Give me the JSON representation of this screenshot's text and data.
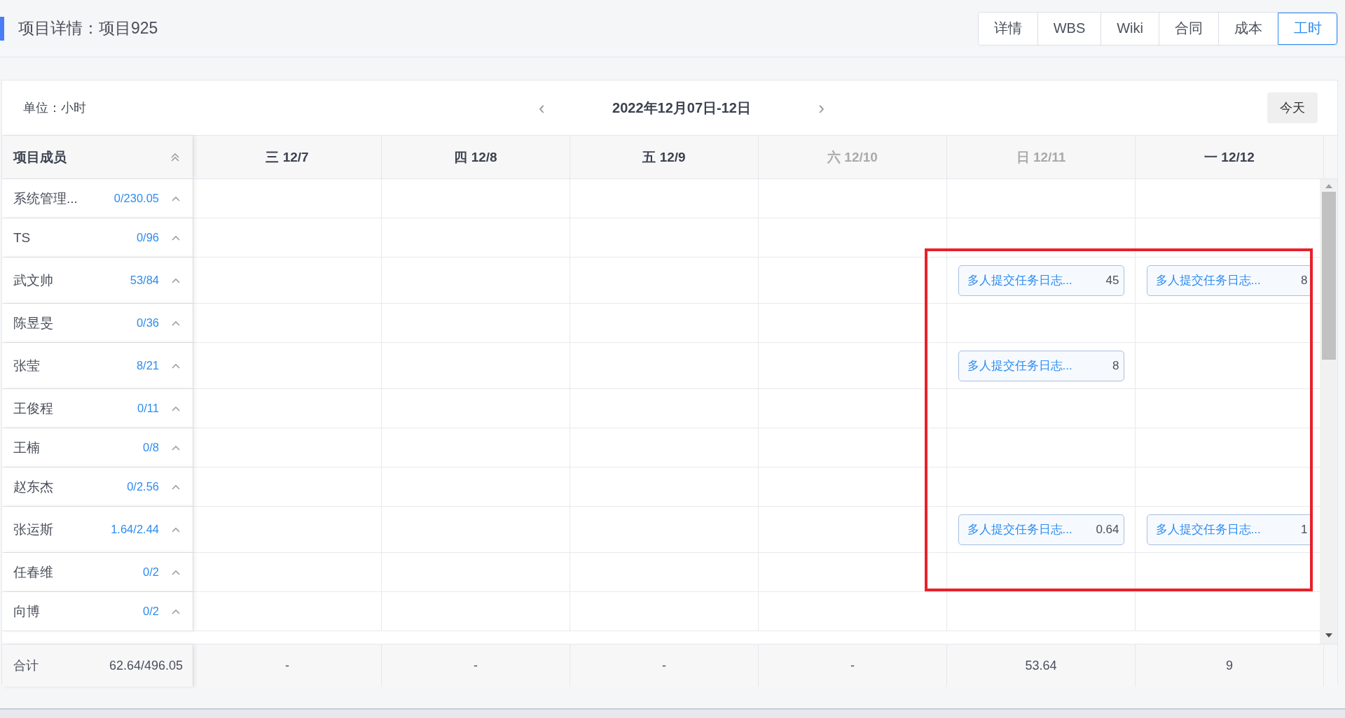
{
  "page_title": "项目详情：项目925",
  "tabs": [
    {
      "label": "详情",
      "selected": false
    },
    {
      "label": "WBS",
      "selected": false
    },
    {
      "label": "Wiki",
      "selected": false
    },
    {
      "label": "合同",
      "selected": false
    },
    {
      "label": "成本",
      "selected": false
    },
    {
      "label": "工时",
      "selected": true
    }
  ],
  "toolbar": {
    "unit": "单位：小时",
    "date_range": "2022年12月07日-12日",
    "prev": "‹",
    "next": "›",
    "today_button": "今天"
  },
  "table": {
    "member_header": "项目成员",
    "days": [
      {
        "label": "三 12/7",
        "weekend": false
      },
      {
        "label": "四 12/8",
        "weekend": false
      },
      {
        "label": "五 12/9",
        "weekend": false
      },
      {
        "label": "六 12/10",
        "weekend": true
      },
      {
        "label": "日 12/11",
        "weekend": true
      },
      {
        "label": "一 12/12",
        "weekend": false
      }
    ],
    "members": [
      {
        "name": "系统管理...",
        "hours": "0/230.05"
      },
      {
        "name": "TS",
        "hours": "0/96"
      },
      {
        "name": "武文帅",
        "hours": "53/84",
        "cells": [
          null,
          null,
          null,
          null,
          {
            "task": "多人提交任务日志...",
            "hours": "45"
          },
          {
            "task": "多人提交任务日志...",
            "hours": "8"
          }
        ]
      },
      {
        "name": "陈昱旻",
        "hours": "0/36"
      },
      {
        "name": "张莹",
        "hours": "8/21",
        "cells": [
          null,
          null,
          null,
          null,
          {
            "task": "多人提交任务日志...",
            "hours": "8"
          },
          null
        ]
      },
      {
        "name": "王俊程",
        "hours": "0/11"
      },
      {
        "name": "王楠",
        "hours": "0/8"
      },
      {
        "name": "赵东杰",
        "hours": "0/2.56"
      },
      {
        "name": "张运斯",
        "hours": "1.64/2.44",
        "cells": [
          null,
          null,
          null,
          null,
          {
            "task": "多人提交任务日志...",
            "hours": "0.64"
          },
          {
            "task": "多人提交任务日志...",
            "hours": "1"
          }
        ]
      },
      {
        "name": "任春维",
        "hours": "0/2"
      },
      {
        "name": "向博",
        "hours": "0/2"
      }
    ],
    "total": {
      "label": "合计",
      "hours": "62.64/496.05",
      "days": [
        "-",
        "-",
        "-",
        "-",
        "53.64",
        "9"
      ]
    }
  }
}
